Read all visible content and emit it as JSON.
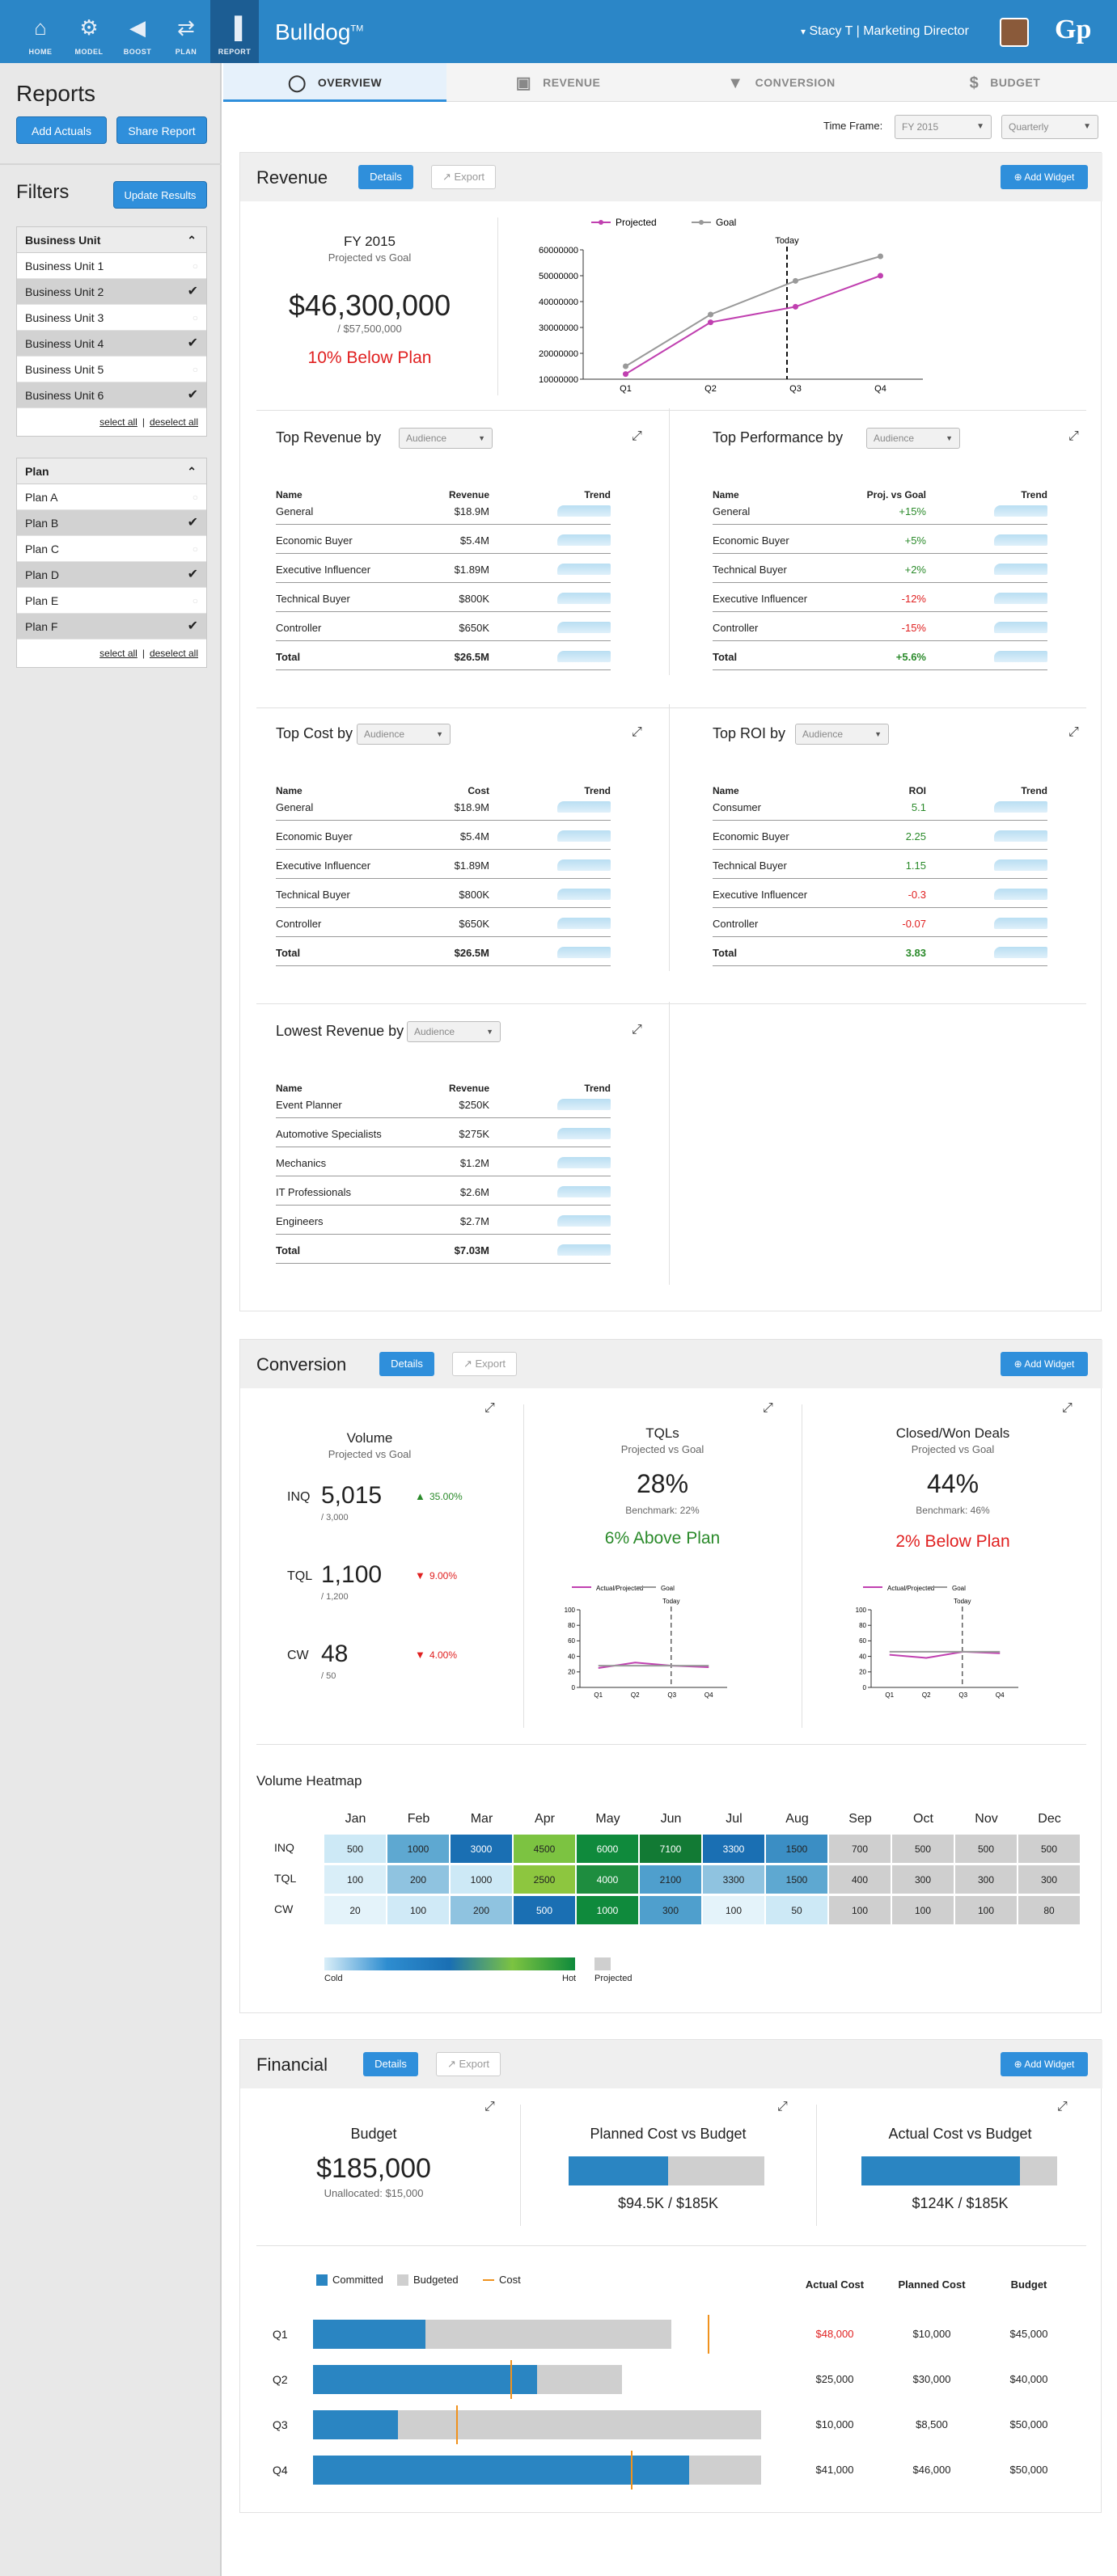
{
  "nav": [
    {
      "label": "HOME",
      "icon": "home-icon"
    },
    {
      "label": "MODEL",
      "icon": "gears-icon"
    },
    {
      "label": "BOOST",
      "icon": "megaphone-icon"
    },
    {
      "label": "PLAN",
      "icon": "shuffle-icon"
    },
    {
      "label": "REPORT",
      "icon": "bar-chart-icon"
    }
  ],
  "brand": "Bulldog",
  "brand_tm": "TM",
  "user": {
    "name": "Stacy T",
    "separator": "|",
    "role": "Marketing Director"
  },
  "logo": "Gp",
  "sidebar": {
    "title": "Reports",
    "add_actuals": "Add Actuals",
    "share_report": "Share Report",
    "filters_title": "Filters",
    "update_results": "Update Results",
    "business_unit": {
      "title": "Business Unit",
      "items": [
        {
          "label": "Business Unit 1",
          "checked": false
        },
        {
          "label": "Business Unit 2",
          "checked": true
        },
        {
          "label": "Business Unit 3",
          "checked": false
        },
        {
          "label": "Business Unit 4",
          "checked": true
        },
        {
          "label": "Business Unit 5",
          "checked": false
        },
        {
          "label": "Business Unit 6",
          "checked": true
        }
      ],
      "select_all": "select all",
      "deselect_all": "deselect all"
    },
    "plan": {
      "title": "Plan",
      "items": [
        {
          "label": "Plan A",
          "checked": false
        },
        {
          "label": "Plan B",
          "checked": true
        },
        {
          "label": "Plan C",
          "checked": false
        },
        {
          "label": "Plan D",
          "checked": true
        },
        {
          "label": "Plan E",
          "checked": false
        },
        {
          "label": "Plan F",
          "checked": true
        }
      ],
      "select_all": "select all",
      "deselect_all": "deselect all"
    }
  },
  "tabs": [
    "OVERVIEW",
    "REVENUE",
    "CONVERSION",
    "BUDGET"
  ],
  "timeframe": {
    "label": "Time Frame:",
    "year": "FY 2015",
    "period": "Quarterly"
  },
  "common": {
    "details": "Details",
    "export": "Export",
    "add_widget": "Add Widget",
    "audience": "Audience",
    "separator": "|"
  },
  "revenue": {
    "title": "Revenue",
    "fy_title": "FY 2015",
    "fy_sub": "Projected vs Goal",
    "amount": "$46,300,000",
    "goal": "/ $57,500,000",
    "status": "10% Below Plan",
    "tables": [
      {
        "title": "Top Revenue by",
        "col2": "Revenue",
        "col3": "Trend",
        "rows": [
          [
            "General",
            "$18.9M"
          ],
          [
            "Economic Buyer",
            "$5.4M"
          ],
          [
            "Executive Influencer",
            "$1.89M"
          ],
          [
            "Technical Buyer",
            "$800K"
          ],
          [
            "Controller",
            "$650K"
          ]
        ],
        "total": [
          "Total",
          "$26.5M"
        ]
      },
      {
        "title": "Top Performance by",
        "col2": "Proj. vs Goal",
        "col3": "Trend",
        "rows": [
          [
            "General",
            "+15%"
          ],
          [
            "Economic Buyer",
            "+5%"
          ],
          [
            "Technical Buyer",
            "+2%"
          ],
          [
            "Executive Influencer",
            "-12%"
          ],
          [
            "Controller",
            "-15%"
          ]
        ],
        "total": [
          "Total",
          "+5.6%"
        ]
      },
      {
        "title": "Top Cost by",
        "col2": "Cost",
        "col3": "Trend",
        "rows": [
          [
            "General",
            "$18.9M"
          ],
          [
            "Economic Buyer",
            "$5.4M"
          ],
          [
            "Executive Influencer",
            "$1.89M"
          ],
          [
            "Technical Buyer",
            "$800K"
          ],
          [
            "Controller",
            "$650K"
          ]
        ],
        "total": [
          "Total",
          "$26.5M"
        ]
      },
      {
        "title": "Top ROI by",
        "col2": "ROI",
        "col3": "Trend",
        "rows": [
          [
            "Consumer",
            "5.1"
          ],
          [
            "Economic Buyer",
            "2.25"
          ],
          [
            "Technical Buyer",
            "1.15"
          ],
          [
            "Executive Influencer",
            "-0.3"
          ],
          [
            "Controller",
            "-0.07"
          ]
        ],
        "total": [
          "Total",
          "3.83"
        ]
      },
      {
        "title": "Lowest Revenue by",
        "col2": "Revenue",
        "col3": "Trend",
        "rows": [
          [
            "Event Planner",
            "$250K"
          ],
          [
            "Automotive Specialists",
            "$275K"
          ],
          [
            "Mechanics",
            "$1.2M"
          ],
          [
            "IT Professionals",
            "$2.6M"
          ],
          [
            "Engineers",
            "$2.7M"
          ]
        ],
        "total": [
          "Total",
          "$7.03M"
        ]
      }
    ],
    "table_name_header": "Name"
  },
  "chart_data": [
    {
      "type": "line",
      "categories": [
        "Q1",
        "Q2",
        "Q3",
        "Q4"
      ],
      "series": [
        {
          "name": "Projected",
          "color": "#c040b0",
          "values": [
            12000000,
            32000000,
            38000000,
            50000000
          ]
        },
        {
          "name": "Goal",
          "color": "#999999",
          "values": [
            15000000,
            35000000,
            48000000,
            57500000
          ]
        }
      ],
      "ylim": [
        10000000,
        60000000
      ],
      "yticks": [
        "60000000",
        "50000000",
        "40000000",
        "30000000",
        "20000000",
        "10000000"
      ],
      "marker": "Today",
      "legend": "top"
    },
    {
      "type": "line",
      "title": "",
      "categories": [
        "Q1",
        "Q2",
        "Q3",
        "Q4"
      ],
      "series": [
        {
          "name": "Actual/Projected",
          "color": "#c040b0",
          "values": [
            25,
            32,
            28,
            26
          ]
        },
        {
          "name": "Goal",
          "color": "#999999",
          "values": [
            28,
            28,
            28,
            28
          ]
        }
      ],
      "ylim": [
        0,
        100
      ],
      "yticks": [
        "100",
        "80",
        "60",
        "40",
        "20",
        "0"
      ],
      "marker": "Today"
    },
    {
      "type": "line",
      "categories": [
        "Q1",
        "Q2",
        "Q3",
        "Q4"
      ],
      "series": [
        {
          "name": "Actual/Projected",
          "color": "#c040b0",
          "values": [
            42,
            38,
            46,
            44
          ]
        },
        {
          "name": "Goal",
          "color": "#999999",
          "values": [
            46,
            46,
            46,
            46
          ]
        }
      ],
      "ylim": [
        0,
        100
      ],
      "yticks": [
        "100",
        "80",
        "60",
        "40",
        "20",
        "0"
      ],
      "marker": "Today"
    }
  ],
  "conversion": {
    "title": "Conversion",
    "volume": {
      "title": "Volume",
      "sub": "Projected vs Goal",
      "rows": [
        {
          "label": "INQ",
          "value": "5,015",
          "goal": "/ 3,000",
          "delta": "35.00%",
          "dir": "up"
        },
        {
          "label": "TQL",
          "value": "1,100",
          "goal": "/ 1,200",
          "delta": "9.00%",
          "dir": "down"
        },
        {
          "label": "CW",
          "value": "48",
          "goal": "/ 50",
          "delta": "4.00%",
          "dir": "down"
        }
      ]
    },
    "tqls": {
      "title": "TQLs",
      "sub": "Projected vs Goal",
      "pct": "28%",
      "bench": "Benchmark: 22%",
      "status": "6% Above Plan"
    },
    "closed": {
      "title": "Closed/Won Deals",
      "sub": "Projected vs Goal",
      "pct": "44%",
      "bench": "Benchmark: 46%",
      "status": "2% Below Plan"
    },
    "heatmap": {
      "title": "Volume Heatmap",
      "months": [
        "Jan",
        "Feb",
        "Mar",
        "Apr",
        "May",
        "Jun",
        "Jul",
        "Aug",
        "Sep",
        "Oct",
        "Nov",
        "Dec"
      ],
      "rows": [
        {
          "label": "INQ",
          "values": [
            "500",
            "1000",
            "3000",
            "4500",
            "6000",
            "7100",
            "3300",
            "1500",
            "700",
            "500",
            "500",
            "500"
          ]
        },
        {
          "label": "TQL",
          "values": [
            "100",
            "200",
            "1000",
            "2500",
            "4000",
            "2100",
            "3300",
            "1500",
            "400",
            "300",
            "300",
            "300"
          ]
        },
        {
          "label": "CW",
          "values": [
            "20",
            "100",
            "200",
            "500",
            "1000",
            "300",
            "100",
            "50",
            "100",
            "100",
            "100",
            "80"
          ]
        }
      ],
      "colors": [
        [
          "#cde9f6",
          "#5ea8d1",
          "#1a6fb3",
          "#7cc341",
          "#0f8a3c",
          "#127a34",
          "#1a6fb3",
          "#3b8ec4",
          "#cfcfcf",
          "#cfcfcf",
          "#cfcfcf",
          "#cfcfcf"
        ],
        [
          "#d9eef8",
          "#8fc3e0",
          "#cde9f6",
          "#8dc63f",
          "#1e8d3f",
          "#4f9fcd",
          "#8fc3e0",
          "#5ea8d1",
          "#cfcfcf",
          "#cfcfcf",
          "#cfcfcf",
          "#cfcfcf"
        ],
        [
          "#e4f3fa",
          "#d0eaf7",
          "#8fc3e0",
          "#1a6fb3",
          "#0f8a3c",
          "#4f9fcd",
          "#e4f3fa",
          "#cde9f6",
          "#cfcfcf",
          "#cfcfcf",
          "#cfcfcf",
          "#cfcfcf"
        ]
      ],
      "legend_cold": "Cold",
      "legend_hot": "Hot",
      "legend_projected": "Projected"
    }
  },
  "financial": {
    "title": "Financial",
    "budget": {
      "title": "Budget",
      "amount": "$185,000",
      "unallocated": "Unallocated: $15,000"
    },
    "planned": {
      "title": "Planned Cost vs Budget",
      "value": "$94.5K / $185K",
      "fraction": 0.51
    },
    "actual": {
      "title": "Actual Cost vs Budget",
      "value": "$124K / $185K",
      "fraction": 0.81
    },
    "legend": {
      "committed": "Committed",
      "budgeted": "Budgeted",
      "cost": "Cost"
    },
    "col_headers": [
      "Actual Cost",
      "Planned Cost",
      "Budget"
    ],
    "quarters": [
      {
        "label": "Q1",
        "committed": 0.25,
        "budgeted": 0.8,
        "cost": 0.88,
        "actual": "$48,000",
        "actual_over": true,
        "planned": "$10,000",
        "budget": "$45,000"
      },
      {
        "label": "Q2",
        "committed": 0.5,
        "budgeted": 0.69,
        "cost": 0.44,
        "actual": "$25,000",
        "actual_over": false,
        "planned": "$30,000",
        "budget": "$40,000"
      },
      {
        "label": "Q3",
        "committed": 0.19,
        "budgeted": 1.0,
        "cost": 0.32,
        "actual": "$10,000",
        "actual_over": false,
        "planned": "$8,500",
        "budget": "$50,000"
      },
      {
        "label": "Q4",
        "committed": 0.84,
        "budgeted": 1.0,
        "cost": 0.71,
        "actual": "$41,000",
        "actual_over": false,
        "planned": "$46,000",
        "budget": "$50,000"
      }
    ]
  }
}
